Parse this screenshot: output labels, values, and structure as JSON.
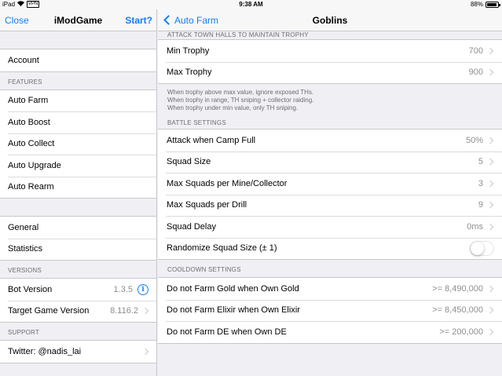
{
  "status_bar": {
    "device": "iPad",
    "vpn": "VPN",
    "time": "9:38 AM",
    "battery": "88%"
  },
  "master": {
    "nav": {
      "left": "Close",
      "title": "iModGame",
      "right": "Start?"
    },
    "account": "Account",
    "features_header": "FEATURES",
    "features": [
      "Auto Farm",
      "Auto Boost",
      "Auto Collect",
      "Auto Upgrade",
      "Auto Rearm"
    ],
    "general": "General",
    "statistics": "Statistics",
    "versions_header": "VERSIONS",
    "bot_version": {
      "label": "Bot Version",
      "value": "1.3.5"
    },
    "target_version": {
      "label": "Target Game Version",
      "value": "8.116.2"
    },
    "support_header": "SUPPORT",
    "twitter": "Twitter: @nadis_lai"
  },
  "detail": {
    "nav": {
      "back": "Auto Farm",
      "title": "Goblins"
    },
    "partial_header": "ATTACK TOWN HALLS TO MAINTAIN TROPHY",
    "trophy": [
      {
        "label": "Min Trophy",
        "value": "700"
      },
      {
        "label": "Max Trophy",
        "value": "900"
      }
    ],
    "trophy_note": [
      "When trophy above max value, ignore exposed THs.",
      "When trophy in range, TH sniping + collector raiding.",
      "When trophy under min value, only TH sniping."
    ],
    "battle_header": "BATTLE SETTINGS",
    "battle": [
      {
        "label": "Attack when Camp Full",
        "value": "50%"
      },
      {
        "label": "Squad Size",
        "value": "5"
      },
      {
        "label": "Max Squads per Mine/Collector",
        "value": "3"
      },
      {
        "label": "Max Squads per Drill",
        "value": "9"
      },
      {
        "label": "Squad Delay",
        "value": "0ms"
      }
    ],
    "randomize": {
      "label": "Randomize Squad Size (± 1)",
      "on": false
    },
    "cooldown_header": "COOLDOWN SETTINGS",
    "cooldown": [
      {
        "label": "Do not Farm Gold when Own Gold",
        "value": ">= 8,490,000"
      },
      {
        "label": "Do not Farm Elixir when Own Elixir",
        "value": ">= 8,450,000"
      },
      {
        "label": "Do not Farm DE when Own DE",
        "value": ">= 200,000"
      }
    ]
  },
  "colors": {
    "accent": "#147efb",
    "background": "#efeff4",
    "separator": "#c8c7cc",
    "secondary_text": "#8e8e93"
  }
}
